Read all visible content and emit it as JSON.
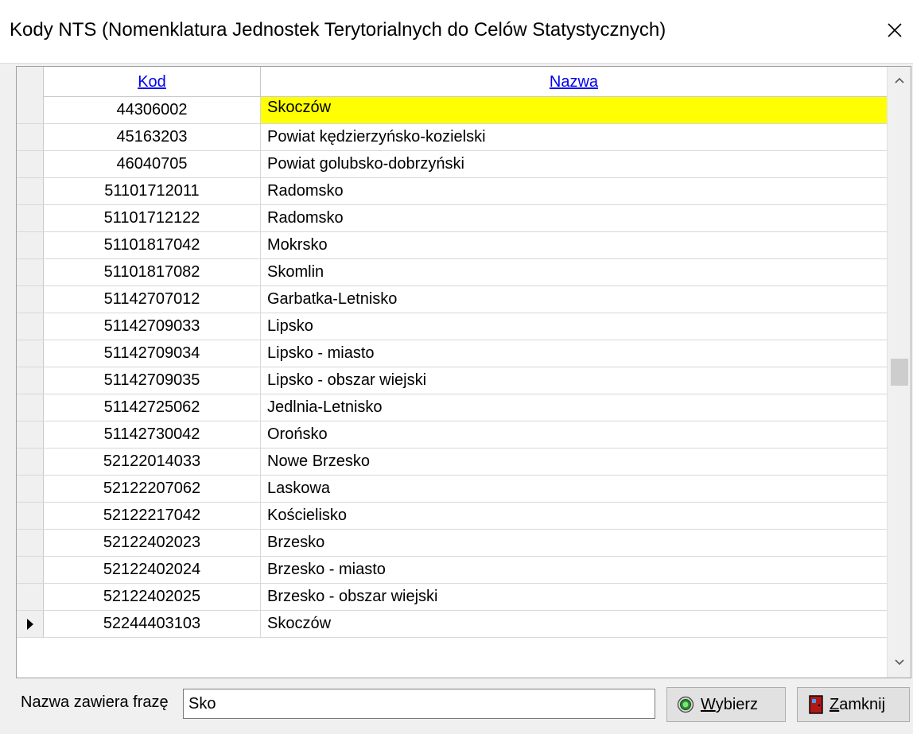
{
  "window": {
    "title": "Kody NTS (Nomenklatura Jednostek Terytorialnych do Celów Statystycznych)"
  },
  "grid": {
    "columns": [
      {
        "key": "kod",
        "label": "Kod"
      },
      {
        "key": "nazwa",
        "label": "Nazwa"
      }
    ],
    "rows": [
      {
        "kod": "44306002",
        "nazwa": "Skoczów",
        "selected": true
      },
      {
        "kod": "45163203",
        "nazwa": "Powiat kędzierzyńsko-kozielski"
      },
      {
        "kod": "46040705",
        "nazwa": "Powiat golubsko-dobrzyński"
      },
      {
        "kod": "51101712011",
        "nazwa": "Radomsko"
      },
      {
        "kod": "51101712122",
        "nazwa": "Radomsko"
      },
      {
        "kod": "51101817042",
        "nazwa": "Mokrsko"
      },
      {
        "kod": "51101817082",
        "nazwa": "Skomlin"
      },
      {
        "kod": "51142707012",
        "nazwa": "Garbatka-Letnisko"
      },
      {
        "kod": "51142709033",
        "nazwa": "Lipsko"
      },
      {
        "kod": "51142709034",
        "nazwa": "Lipsko - miasto"
      },
      {
        "kod": "51142709035",
        "nazwa": "Lipsko - obszar wiejski"
      },
      {
        "kod": "51142725062",
        "nazwa": "Jedlnia-Letnisko"
      },
      {
        "kod": "51142730042",
        "nazwa": "Orońsko"
      },
      {
        "kod": "52122014033",
        "nazwa": "Nowe Brzesko"
      },
      {
        "kod": "52122207062",
        "nazwa": "Laskowa"
      },
      {
        "kod": "52122217042",
        "nazwa": "Kościelisko"
      },
      {
        "kod": "52122402023",
        "nazwa": "Brzesko"
      },
      {
        "kod": "52122402024",
        "nazwa": "Brzesko - miasto"
      },
      {
        "kod": "52122402025",
        "nazwa": "Brzesko - obszar wiejski"
      },
      {
        "kod": "52244403103",
        "nazwa": "Skoczów",
        "current": true
      }
    ],
    "selected_highlight_color": "#ffff00"
  },
  "footer": {
    "search_label": "Nazwa zawiera frazę",
    "search_value": "Sko",
    "select_button": {
      "mnemonic": "W",
      "rest": "ybierz",
      "icon": "green-radio-icon"
    },
    "close_button": {
      "mnemonic": "Z",
      "rest": "amknij",
      "icon": "door-exit-icon"
    }
  }
}
